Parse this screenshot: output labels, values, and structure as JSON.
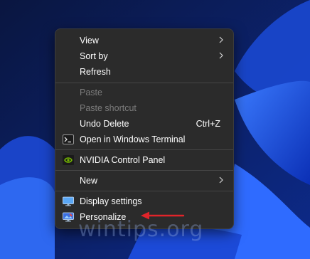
{
  "menu": {
    "items": [
      {
        "label": "View",
        "has_submenu": true
      },
      {
        "label": "Sort by",
        "has_submenu": true
      },
      {
        "label": "Refresh"
      },
      {
        "label": "Paste",
        "disabled": true
      },
      {
        "label": "Paste shortcut",
        "disabled": true
      },
      {
        "label": "Undo Delete",
        "shortcut": "Ctrl+Z"
      },
      {
        "label": "Open in Windows Terminal",
        "icon": "terminal-icon"
      },
      {
        "label": "NVIDIA Control Panel",
        "icon": "nvidia-icon"
      },
      {
        "label": "New",
        "has_submenu": true
      },
      {
        "label": "Display settings",
        "icon": "display-icon"
      },
      {
        "label": "Personalize",
        "icon": "personalize-icon"
      }
    ]
  },
  "watermark": "wintips.org",
  "colors": {
    "menu_bg": "#2b2b2b",
    "separator": "#454545",
    "arrow": "#e0242a",
    "nvidia_green": "#76b900",
    "wallpaper_blue": "#1e4fd8"
  }
}
